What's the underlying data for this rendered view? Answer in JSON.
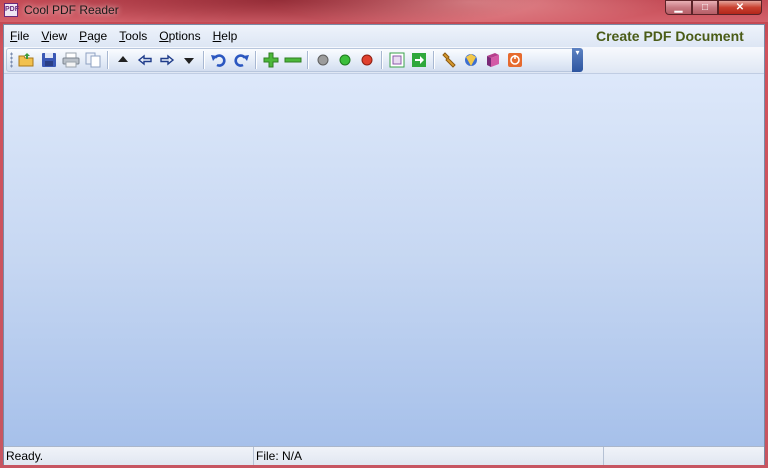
{
  "window": {
    "title": "Cool PDF Reader",
    "app_icon_glyph": "PDF"
  },
  "caption": {
    "minimize": "▁",
    "maximize": "□",
    "close": "✕"
  },
  "menu": [
    {
      "label": "File",
      "accel": "F",
      "rest": "ile"
    },
    {
      "label": "View",
      "accel": "V",
      "rest": "iew"
    },
    {
      "label": "Page",
      "accel": "P",
      "rest": "age"
    },
    {
      "label": "Tools",
      "accel": "T",
      "rest": "ools"
    },
    {
      "label": "Options",
      "accel": "O",
      "rest": "ptions"
    },
    {
      "label": "Help",
      "accel": "H",
      "rest": "elp"
    }
  ],
  "toolbar": {
    "groups": [
      [
        "open-folder-icon",
        "save-icon",
        "print-icon",
        "copy-icon"
      ],
      [
        "first-page-icon",
        "previous-page-icon",
        "next-page-icon",
        "last-page-icon"
      ],
      [
        "rotate-left-icon",
        "rotate-right-icon"
      ],
      [
        "zoom-in-icon",
        "zoom-out-icon"
      ],
      [
        "gray-circle-icon",
        "green-circle-icon",
        "red-circle-icon"
      ],
      [
        "fit-page-icon",
        "go-arrow-icon"
      ],
      [
        "tools-wrench-icon",
        "shield-update-icon",
        "book-icon",
        "power-icon"
      ]
    ],
    "overflow_glyph": "▾"
  },
  "create_pdf": {
    "label": "Create PDF Document"
  },
  "status": {
    "left": "Ready.",
    "middle": "File: N/A",
    "right": ""
  },
  "colors": {
    "accent_green": "#4a5c17",
    "workspace_top": "#dde8fa",
    "workspace_bottom": "#a6c0ea"
  }
}
